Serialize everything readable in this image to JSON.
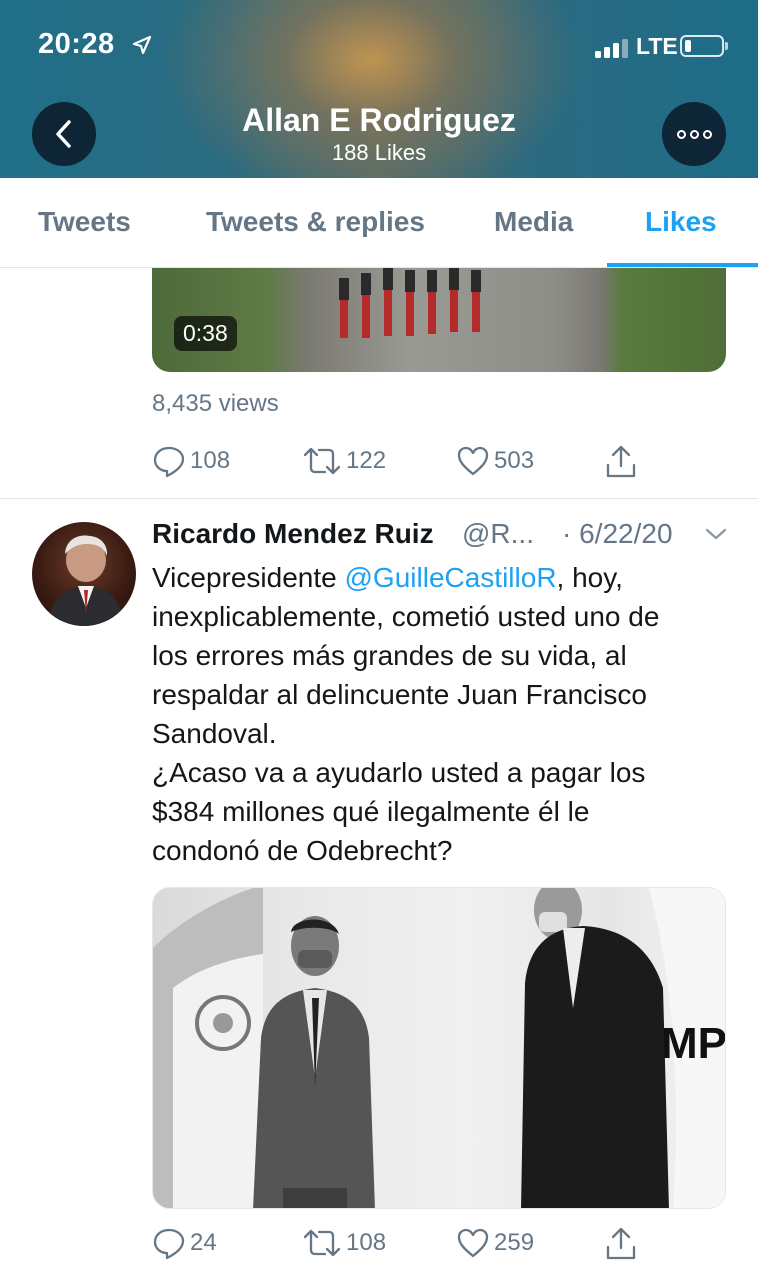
{
  "status_bar": {
    "time": "20:28",
    "network": "LTE"
  },
  "header": {
    "name": "Allan E Rodriguez",
    "subtitle": "188 Likes"
  },
  "tabs": [
    {
      "label": "Tweets",
      "active": false
    },
    {
      "label": "Tweets & replies",
      "active": false
    },
    {
      "label": "Media",
      "active": false
    },
    {
      "label": "Likes",
      "active": true
    }
  ],
  "tweet1": {
    "video_duration": "0:38",
    "views": "8,435 views",
    "replies": "108",
    "retweets": "122",
    "likes": "503"
  },
  "tweet2": {
    "name": "Ricardo Mendez Ruiz",
    "handle": "@R...",
    "date": "· 6/22/20",
    "text_lines": {
      "l1_before": "Vicepresidente ",
      "l1_mention": "@GuilleCastilloR",
      "l1_after": ", hoy,",
      "l2": "inexplicablemente, cometió usted uno de",
      "l3": "los errores más grandes de su vida, al",
      "l4": "respaldar al delincuente Juan Francisco",
      "l5": "Sandoval.",
      "l6": "¿Acaso va a ayudarlo usted a pagar los",
      "l7": "$384 millones qué ilegalmente él le",
      "l8": "condonó de Odebrecht?"
    },
    "replies": "24",
    "retweets": "108",
    "likes": "259"
  },
  "colors": {
    "accent": "#1da1f2",
    "secondary_text": "#657786",
    "divider": "#e1e8ed"
  }
}
